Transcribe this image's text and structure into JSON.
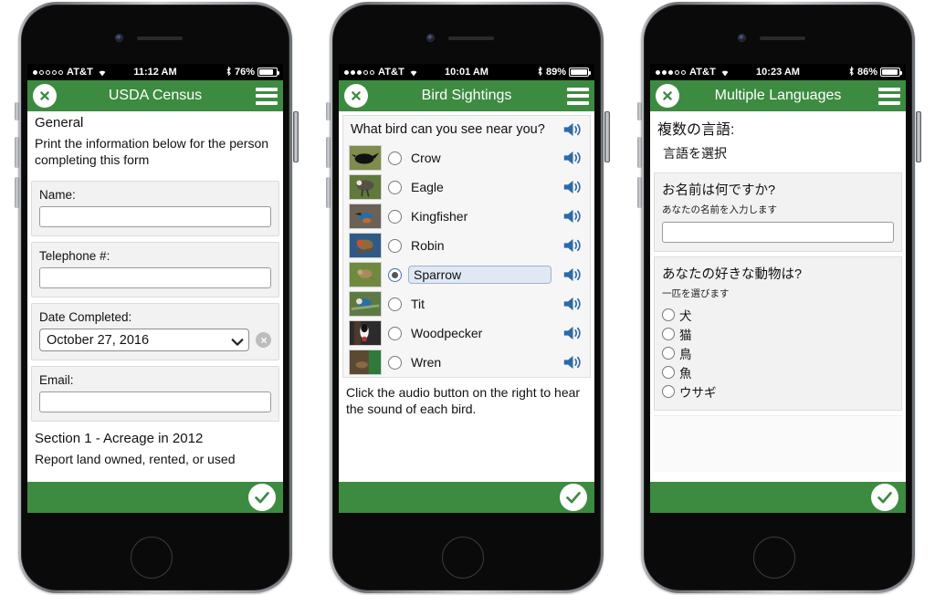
{
  "phones": [
    {
      "id": "usda-census",
      "status": {
        "signal_dots": [
          true,
          false,
          false,
          false,
          false
        ],
        "carrier": "AT&T",
        "time": "11:12 AM",
        "battery_pct": "76%",
        "bluetooth_icon": "bluetooth-icon",
        "wifi_icon": "wifi-icon"
      },
      "header": {
        "close_icon": "close-icon",
        "title": "USDA Census",
        "menu_icon": "hamburger-menu-icon"
      },
      "form": {
        "section_title": "General",
        "section_body": "Print the information below for the person completing this form",
        "fields": [
          {
            "label": "Name:",
            "value": "",
            "type": "text"
          },
          {
            "label": "Telephone #:",
            "value": "",
            "type": "text"
          },
          {
            "label": "Date Completed:",
            "value": "October 27, 2016",
            "type": "select"
          },
          {
            "label": "Email:",
            "value": "",
            "type": "text"
          }
        ],
        "next_section_title": "Section 1 - Acreage in 2012",
        "next_section_body": "Report land owned, rented, or used"
      },
      "footer": {
        "confirm_icon": "checkmark-icon"
      }
    },
    {
      "id": "bird-sightings",
      "status": {
        "signal_dots": [
          true,
          true,
          true,
          false,
          false
        ],
        "carrier": "AT&T",
        "time": "10:01 AM",
        "battery_pct": "89%",
        "bluetooth_icon": "bluetooth-icon",
        "wifi_icon": "wifi-icon"
      },
      "header": {
        "close_icon": "close-icon",
        "title": "Bird Sightings",
        "menu_icon": "hamburger-menu-icon"
      },
      "question": "What bird can you see near you?",
      "question_audio_icon": "speaker-icon",
      "birds": [
        {
          "label": "Crow",
          "selected": false,
          "audio_icon": "speaker-icon",
          "thumb": "crow-thumbnail"
        },
        {
          "label": "Eagle",
          "selected": false,
          "audio_icon": "speaker-icon",
          "thumb": "eagle-thumbnail"
        },
        {
          "label": "Kingfisher",
          "selected": false,
          "audio_icon": "speaker-icon",
          "thumb": "kingfisher-thumbnail"
        },
        {
          "label": "Robin",
          "selected": false,
          "audio_icon": "speaker-icon",
          "thumb": "robin-thumbnail"
        },
        {
          "label": "Sparrow",
          "selected": true,
          "audio_icon": "speaker-icon",
          "thumb": "sparrow-thumbnail"
        },
        {
          "label": "Tit",
          "selected": false,
          "audio_icon": "speaker-icon",
          "thumb": "tit-thumbnail"
        },
        {
          "label": "Woodpecker",
          "selected": false,
          "audio_icon": "speaker-icon",
          "thumb": "woodpecker-thumbnail"
        },
        {
          "label": "Wren",
          "selected": false,
          "audio_icon": "speaker-icon",
          "thumb": "wren-thumbnail"
        }
      ],
      "hint": "Click the audio button on the right to hear the sound of each bird.",
      "footer": {
        "confirm_icon": "checkmark-icon"
      }
    },
    {
      "id": "multiple-languages",
      "status": {
        "signal_dots": [
          true,
          true,
          true,
          false,
          false
        ],
        "carrier": "AT&T",
        "time": "10:23 AM",
        "battery_pct": "86%",
        "bluetooth_icon": "bluetooth-icon",
        "wifi_icon": "wifi-icon"
      },
      "header": {
        "close_icon": "close-icon",
        "title": "Multiple Languages",
        "menu_icon": "hamburger-menu-icon"
      },
      "page_title": "複数の言語:",
      "page_subtitle": "言語を選択",
      "name_question": "お名前は何ですか?",
      "name_help": "あなたの名前を入力します",
      "name_value": "",
      "animal_question": "あなたの好きな動物は?",
      "animal_help": "一匹を選びます",
      "animals": [
        {
          "label": "犬",
          "selected": false
        },
        {
          "label": "猫",
          "selected": false
        },
        {
          "label": "鳥",
          "selected": false
        },
        {
          "label": "魚",
          "selected": false
        },
        {
          "label": "ウサギ",
          "selected": false
        }
      ],
      "footer": {
        "confirm_icon": "checkmark-icon"
      }
    }
  ],
  "theme": {
    "header_green": "#3d8b40",
    "speaker_blue": "#2d6aa8",
    "panel_gray": "#f2f2f2",
    "page_background": "#ffffff"
  }
}
